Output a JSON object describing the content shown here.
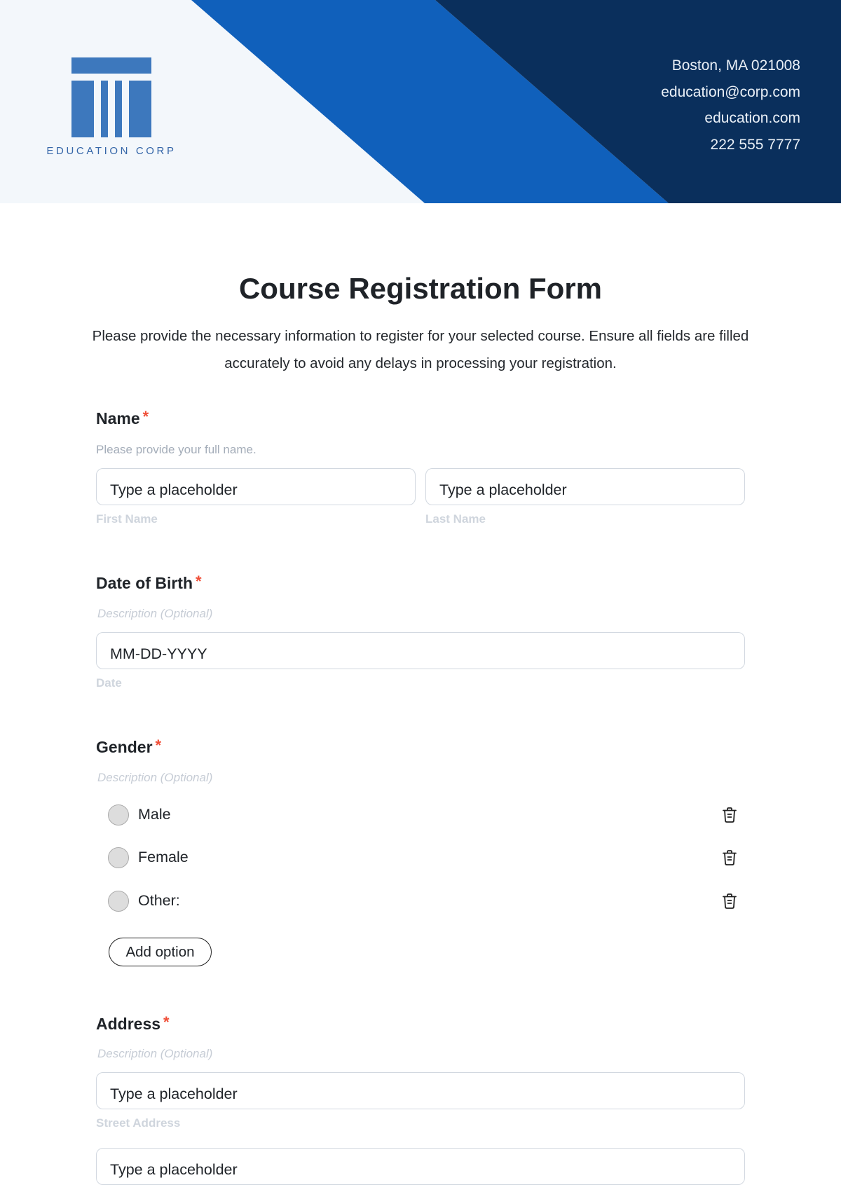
{
  "header": {
    "brand": "EDUCATION CORP",
    "contact": {
      "address": "Boston, MA 021008",
      "email": "education@corp.com",
      "website": "education.com",
      "phone": "222 555 7777"
    },
    "colors": {
      "light": "#f3f7fb",
      "blue": "#1060bb",
      "navy": "#0a2f5c",
      "logo": "#3d78bd"
    }
  },
  "form": {
    "title": "Course Registration Form",
    "intro": "Please provide the necessary information to register for your selected course. Ensure all fields are filled accurately to avoid any delays in processing your registration.",
    "required_mark": "*",
    "fields": {
      "name": {
        "label": "Name",
        "description": "Please provide your full name.",
        "first": {
          "placeholder": "Type a placeholder",
          "sublabel": "First Name"
        },
        "last": {
          "placeholder": "Type a placeholder",
          "sublabel": "Last Name"
        }
      },
      "dob": {
        "label": "Date of Birth",
        "description": "Description (Optional)",
        "placeholder": "MM-DD-YYYY",
        "sublabel": "Date"
      },
      "gender": {
        "label": "Gender",
        "description": "Description (Optional)",
        "options": [
          {
            "label": "Male",
            "icon": "trash-icon"
          },
          {
            "label": "Female",
            "icon": "trash-icon"
          },
          {
            "label": "Other:",
            "icon": "trash-icon"
          }
        ],
        "add_option_label": "Add option"
      },
      "address": {
        "label": "Address",
        "description": "Description (Optional)",
        "street": {
          "placeholder": "Type a placeholder",
          "sublabel": "Street Address"
        },
        "line2": {
          "placeholder": "Type a placeholder"
        }
      }
    }
  }
}
